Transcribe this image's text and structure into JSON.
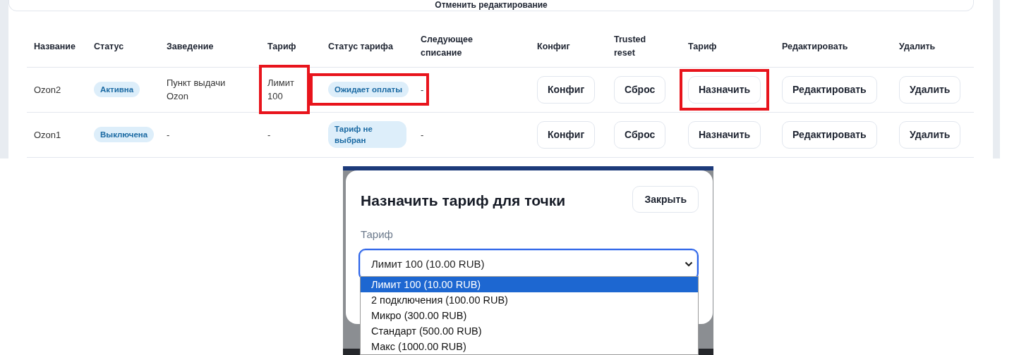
{
  "toolbar": {
    "cancel_button": "Отменить редактирование"
  },
  "table": {
    "columns": [
      "Название",
      "Статус",
      "Заведение",
      "Тариф",
      "Статус тарифа",
      "Следующее списание",
      "Конфиг",
      "Trusted reset",
      "Тариф",
      "Редактировать",
      "Удалить"
    ],
    "rows": [
      {
        "name": "Ozon2",
        "status": "Активна",
        "venue": "Пункт выдачи Ozon",
        "plan": "Лимит 100",
        "plan_status": "Ожидает оплаты",
        "next_charge": "-",
        "config_button": "Конфиг",
        "reset_button": "Сброс",
        "assign_button": "Назначить",
        "edit_button": "Редактировать",
        "delete_button": "Удалить",
        "plan_highlighted": true,
        "plan_status_highlighted": true,
        "assign_highlighted": true
      },
      {
        "name": "Ozon1",
        "status": "Выключена",
        "venue": "-",
        "plan": "-",
        "plan_status": "Тариф не выбран",
        "next_charge": "-",
        "config_button": "Конфиг",
        "reset_button": "Сброс",
        "assign_button": "Назначить",
        "edit_button": "Редактировать",
        "delete_button": "Удалить",
        "plan_highlighted": false,
        "plan_status_highlighted": false,
        "assign_highlighted": false
      }
    ]
  },
  "dialog": {
    "title": "Назначить тариф для точки",
    "close_button": "Закрыть",
    "field_label": "Тариф",
    "select": {
      "value": "Лимит 100 (10.00 RUB)"
    },
    "options": [
      {
        "label": "Лимит 100 (10.00 RUB)",
        "selected": true
      },
      {
        "label": "2 подключения (100.00 RUB)",
        "selected": false
      },
      {
        "label": "Микро (300.00 RUB)",
        "selected": false
      },
      {
        "label": "Стандарт (500.00 RUB)",
        "selected": false
      },
      {
        "label": "Макс (1000.00 RUB)",
        "selected": false
      }
    ]
  }
}
